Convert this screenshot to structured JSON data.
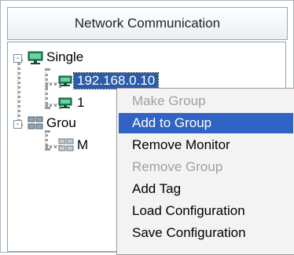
{
  "header": {
    "title": "Network Communication"
  },
  "tree": {
    "nodes": [
      {
        "label": "Single",
        "expanded": "-",
        "selected": false
      },
      {
        "label": "192.168.0.10",
        "selected": true
      },
      {
        "label": "1",
        "selected": false
      },
      {
        "label": "Grou",
        "expanded": "-",
        "selected": false
      },
      {
        "label": "M",
        "selected": false
      }
    ]
  },
  "context_menu": {
    "items": [
      {
        "label": "Make Group",
        "state": "disabled"
      },
      {
        "label": "Add to Group",
        "state": "active"
      },
      {
        "label": "Remove Monitor",
        "state": "normal"
      },
      {
        "label": "Remove Group",
        "state": "disabled"
      },
      {
        "label": "Add Tag",
        "state": "normal"
      },
      {
        "label": "Load Configuration",
        "state": "normal"
      },
      {
        "label": "Save Configuration",
        "state": "normal"
      }
    ]
  },
  "colors": {
    "selection": "#2b5caa",
    "menu_highlight": "#3163c4",
    "disabled_text": "#a0a0a0",
    "monitor_icon": "#1a8a5a"
  }
}
